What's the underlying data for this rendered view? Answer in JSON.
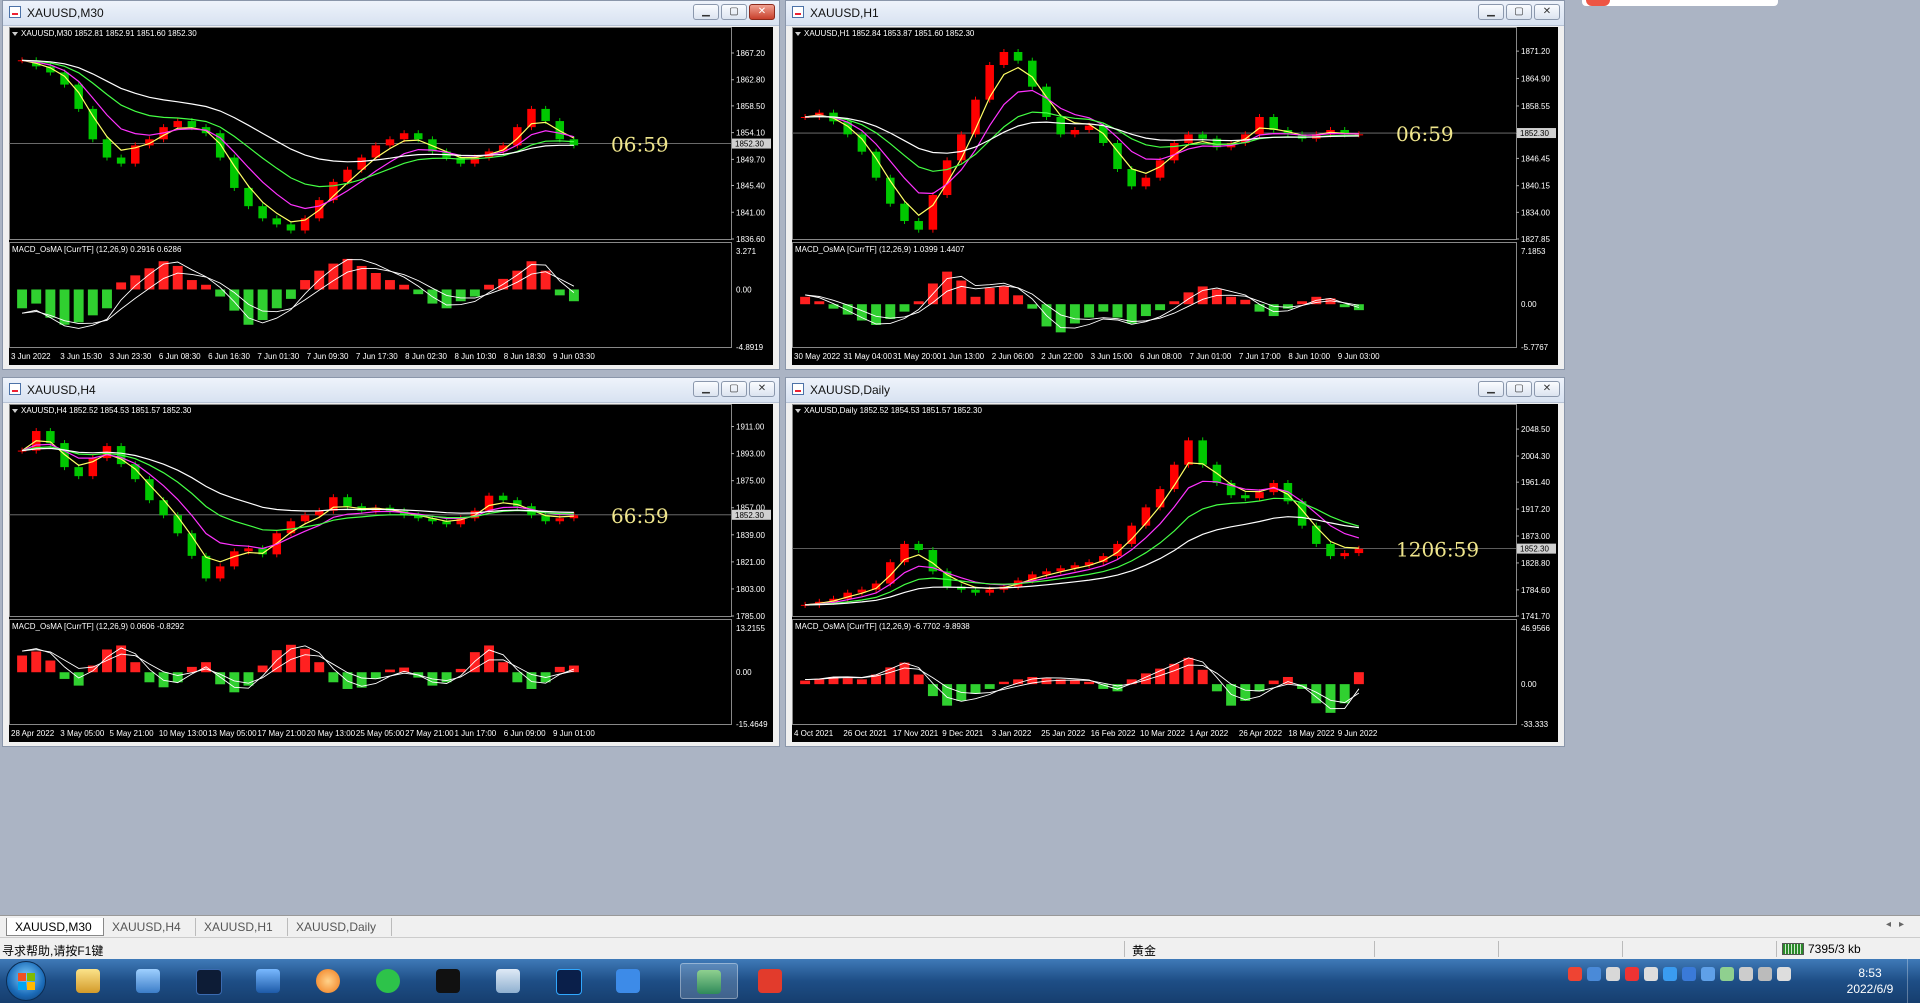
{
  "windows": [
    {
      "id": "m30",
      "title": "XAUUSD,M30",
      "header": "XAUUSD,M30  1852.81 1852.91 1851.60 1852.30",
      "macd_header": "MACD_OsMA [CurrTF] (12,26,9) 0.2916 0.6286",
      "countdown": "06:59",
      "price_ticks": [
        "1867.20",
        "1862.80",
        "1858.50",
        "1854.10",
        "1849.70",
        "1845.40",
        "1841.00",
        "1836.60"
      ],
      "price_range": [
        1836.6,
        1869.5
      ],
      "current_price": "1852.30",
      "current_value": 1852.3,
      "macd_ticks": [
        "3.271",
        "0.00",
        "-4.8919"
      ],
      "macd_range": [
        -4.8919,
        3.271
      ],
      "time_labels": [
        "3 Jun 2022",
        "3 Jun 15:30",
        "3 Jun 23:30",
        "6 Jun 08:30",
        "6 Jun 16:30",
        "7 Jun 01:30",
        "7 Jun 09:30",
        "7 Jun 17:30",
        "8 Jun 02:30",
        "8 Jun 10:30",
        "8 Jun 18:30",
        "9 Jun 03:30"
      ],
      "close_series": [
        1866,
        1865,
        1864,
        1862,
        1858,
        1853,
        1850,
        1849,
        1852,
        1853,
        1855,
        1856,
        1855,
        1854,
        1850,
        1845,
        1842,
        1840,
        1839,
        1838,
        1840,
        1843,
        1846,
        1848,
        1850,
        1852,
        1853,
        1854,
        1853,
        1851,
        1850,
        1849,
        1850,
        1851,
        1852,
        1855,
        1858,
        1856,
        1853,
        1852
      ],
      "histogram": [
        -1.6,
        -1.2,
        -2.4,
        -3.0,
        -2.8,
        -2.2,
        -1.6,
        0.6,
        1.2,
        1.8,
        2.4,
        2.0,
        0.8,
        0.4,
        -0.6,
        -1.8,
        -3.0,
        -2.6,
        -1.6,
        -0.8,
        0.8,
        1.6,
        2.2,
        2.6,
        2.0,
        1.4,
        0.8,
        0.4,
        -0.4,
        -1.2,
        -1.6,
        -1.0,
        -0.6,
        0.4,
        0.9,
        1.6,
        2.4,
        1.6,
        -0.5,
        -1.0
      ],
      "ma_colors": [
        "#ffff66",
        "#ff33ff",
        "#44ff44",
        "#ffffff"
      ]
    },
    {
      "id": "h1",
      "title": "XAUUSD,H1",
      "header": "XAUUSD,H1  1852.84 1853.87 1851.60 1852.30",
      "macd_header": "MACD_OsMA [CurrTF] (12,26,9) 1.0399 1.4407",
      "countdown": "06:59",
      "price_ticks": [
        "1871.20",
        "1864.90",
        "1858.55",
        "1852.20",
        "1846.45",
        "1840.15",
        "1834.00",
        "1827.85"
      ],
      "price_range": [
        1827.85,
        1874.0
      ],
      "current_price": "1852.30",
      "current_value": 1852.3,
      "macd_ticks": [
        "7.1853",
        "0.00",
        "-5.7767"
      ],
      "macd_range": [
        -5.7767,
        7.1853
      ],
      "time_labels": [
        "30 May 2022",
        "31 May 04:00",
        "31 May 20:00",
        "1 Jun 13:00",
        "2 Jun 06:00",
        "2 Jun 22:00",
        "3 Jun 15:00",
        "6 Jun 08:00",
        "7 Jun 01:00",
        "7 Jun 17:00",
        "8 Jun 10:00",
        "9 Jun 03:00"
      ],
      "close_series": [
        1856,
        1857,
        1855,
        1852,
        1848,
        1842,
        1836,
        1832,
        1830,
        1838,
        1846,
        1852,
        1860,
        1868,
        1871,
        1869,
        1863,
        1856,
        1852,
        1853,
        1854,
        1850,
        1844,
        1840,
        1842,
        1846,
        1850,
        1852,
        1851,
        1849,
        1850,
        1852,
        1856,
        1853,
        1852,
        1851,
        1852,
        1853,
        1852,
        1852
      ],
      "histogram": [
        1.0,
        0.4,
        -0.6,
        -1.4,
        -2.2,
        -2.8,
        -2.0,
        -1.0,
        0.4,
        2.8,
        4.4,
        3.2,
        1.0,
        2.2,
        2.4,
        1.2,
        -0.6,
        -3.0,
        -3.8,
        -2.6,
        -1.8,
        -1.0,
        -1.8,
        -2.6,
        -1.6,
        -0.8,
        0.4,
        1.6,
        2.4,
        2.0,
        1.0,
        0.6,
        -1.0,
        -1.6,
        -0.6,
        0.4,
        1.0,
        0.8,
        -0.4,
        -0.8
      ],
      "ma_colors": [
        "#ffff66",
        "#ff33ff",
        "#44ff44",
        "#ffffff"
      ]
    },
    {
      "id": "h4",
      "title": "XAUUSD,H4",
      "header": "XAUUSD,H4  1852.52 1854.53 1851.57 1852.30",
      "macd_header": "MACD_OsMA [CurrTF] (12,26,9) 0.0606 -0.8292",
      "countdown": "66:59",
      "price_ticks": [
        "1911.00",
        "1893.00",
        "1875.00",
        "1857.00",
        "1839.00",
        "1821.00",
        "1803.00",
        "1785.00"
      ],
      "price_range": [
        1785.0,
        1918.0
      ],
      "current_price": "1852.30",
      "current_value": 1852.3,
      "macd_ticks": [
        "13.2155",
        "0.00",
        "-15.4649"
      ],
      "macd_range": [
        -15.4649,
        13.2155
      ],
      "time_labels": [
        "28 Apr 2022",
        "3 May 05:00",
        "5 May 21:00",
        "10 May 13:00",
        "13 May 05:00",
        "17 May 21:00",
        "20 May 13:00",
        "25 May 05:00",
        "27 May 21:00",
        "1 Jun 17:00",
        "6 Jun 09:00",
        "9 Jun 01:00"
      ],
      "close_series": [
        1895,
        1908,
        1900,
        1884,
        1878,
        1890,
        1898,
        1886,
        1876,
        1862,
        1852,
        1840,
        1825,
        1810,
        1818,
        1828,
        1830,
        1826,
        1840,
        1848,
        1852,
        1855,
        1864,
        1858,
        1855,
        1857,
        1855,
        1852,
        1850,
        1848,
        1846,
        1850,
        1855,
        1865,
        1862,
        1858,
        1852,
        1848,
        1850,
        1852
      ],
      "histogram": [
        5.0,
        6.2,
        3.5,
        -2.0,
        -4.0,
        2.0,
        6.8,
        8.0,
        3.0,
        -3.0,
        -4.5,
        -3.0,
        1.6,
        3.0,
        -3.6,
        -6.0,
        -4.0,
        2.0,
        6.6,
        8.2,
        7.0,
        3.0,
        -3.0,
        -5.0,
        -4.6,
        -2.0,
        0.8,
        1.4,
        -1.6,
        -4.0,
        -3.0,
        1.0,
        6.0,
        8.0,
        3.0,
        -3.0,
        -5.0,
        -3.0,
        1.6,
        2.0
      ],
      "ma_colors": [
        "#ffff66",
        "#ff33ff",
        "#44ff44",
        "#ffffff"
      ]
    },
    {
      "id": "daily",
      "title": "XAUUSD,Daily",
      "header": "XAUUSD,Daily  1852.52 1854.53 1851.57 1852.30",
      "macd_header": "MACD_OsMA [CurrTF] (12,26,9) -6.7702 -9.8938",
      "countdown": "1206:59",
      "price_ticks": [
        "2048.50",
        "2004.30",
        "1961.40",
        "1917.20",
        "1873.00",
        "1828.80",
        "1784.60",
        "1741.70"
      ],
      "price_range": [
        1741.7,
        2070.0
      ],
      "current_price": "1852.30",
      "current_value": 1852.3,
      "macd_ticks": [
        "46.9566",
        "0.00",
        "-33.333"
      ],
      "macd_range": [
        -33.333,
        46.9566
      ],
      "time_labels": [
        "4 Oct 2021",
        "26 Oct 2021",
        "17 Nov 2021",
        "9 Dec 2021",
        "3 Jan 2022",
        "25 Jan 2022",
        "16 Feb 2022",
        "10 Mar 2022",
        "1 Apr 2022",
        "26 Apr 2022",
        "18 May 2022",
        "9 Jun 2022"
      ],
      "close_series": [
        1760,
        1765,
        1770,
        1780,
        1785,
        1795,
        1830,
        1860,
        1850,
        1815,
        1790,
        1785,
        1780,
        1785,
        1790,
        1800,
        1810,
        1815,
        1820,
        1825,
        1830,
        1840,
        1860,
        1890,
        1920,
        1950,
        1990,
        2030,
        1990,
        1960,
        1940,
        1935,
        1945,
        1960,
        1930,
        1890,
        1860,
        1840,
        1845,
        1852
      ],
      "histogram": [
        3.0,
        4.0,
        6.0,
        5.0,
        4.0,
        8.0,
        14.0,
        18.0,
        8.0,
        -10.0,
        -18.0,
        -14.0,
        -8.0,
        -4.0,
        2.0,
        4.0,
        6.0,
        5.0,
        4.0,
        3.0,
        2.0,
        -4.0,
        -6.0,
        4.0,
        9.0,
        13.0,
        17.0,
        22.0,
        12.0,
        -6.0,
        -18.0,
        -14.0,
        -6.0,
        3.0,
        6.0,
        -4.0,
        -16.0,
        -24.0,
        -16.0,
        10.0
      ],
      "ma_colors": [
        "#ffff66",
        "#ff33ff",
        "#44ff44",
        "#ffffff"
      ]
    }
  ],
  "tabs": [
    "XAUUSD,M30",
    "XAUUSD,H4",
    "XAUUSD,H1",
    "XAUUSD,Daily"
  ],
  "active_tab": 0,
  "status": {
    "help": "寻求帮助,请按F1键",
    "symbol_name": "黄金",
    "traffic": "7395/3 kb"
  },
  "clock": {
    "time": "8:53",
    "date": "2022/6/9"
  },
  "taskbar_icons": [
    "start-orb",
    "explorer-icon",
    "control-panel-icon",
    "metatrader-icon",
    "screen-icon",
    "browser-icon",
    "wechat-icon",
    "capcut-icon",
    "folder-icon",
    "photoshop-icon",
    "notes-icon",
    "trading-app-icon",
    "wps-icon"
  ],
  "colors": {
    "bull_candle": "#ff0000",
    "bear_candle": "#00c800",
    "hist_pos": "#ff2020",
    "hist_neg": "#30d030",
    "countdown": "#f0e68c",
    "axis_text": "#ffffff"
  }
}
